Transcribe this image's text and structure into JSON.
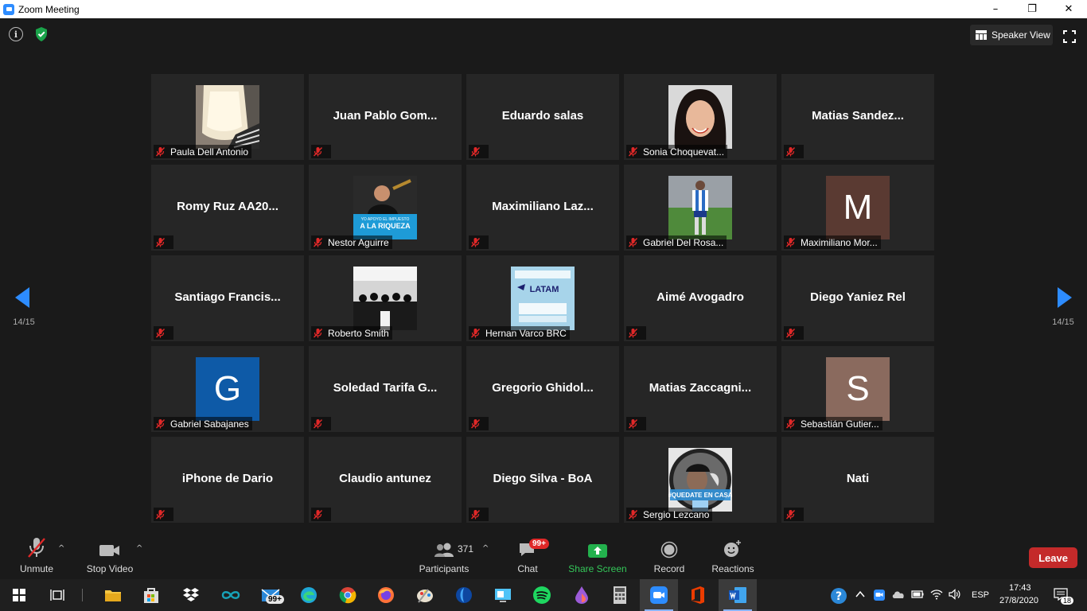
{
  "window": {
    "title": "Zoom Meeting",
    "controls": [
      "–",
      "❐",
      "✕"
    ]
  },
  "top": {
    "speaker_view_label": "Speaker View"
  },
  "pagination": {
    "left_label": "14/15",
    "right_label": "14/15"
  },
  "participants": [
    {
      "name": "Paula Dell Antonio",
      "kind": "photo",
      "photo": "blonde"
    },
    {
      "name": "Juan  Pablo Gom...",
      "kind": "name"
    },
    {
      "name": "Eduardo salas",
      "kind": "name"
    },
    {
      "name": "Sonia Choquevat...",
      "kind": "photo",
      "photo": "woman"
    },
    {
      "name": "Matias  Sandez...",
      "kind": "name"
    },
    {
      "name": "Romy Ruz AA20...",
      "kind": "name"
    },
    {
      "name": "Nestor Aguirre",
      "kind": "photo",
      "photo": "nestor",
      "photo_caption_1": "YO APOYO EL IMPUESTO",
      "photo_caption_2": "A LA RIQUEZA"
    },
    {
      "name": "Maximiliano  Laz...",
      "kind": "name"
    },
    {
      "name": "Gabriel Del Rosa...",
      "kind": "photo",
      "photo": "soccer"
    },
    {
      "name": "Maximiliano Mor...",
      "kind": "letter",
      "letter": "M",
      "color": "#5a3a32"
    },
    {
      "name": "Santiago  Francis...",
      "kind": "name"
    },
    {
      "name": "Roberto Smith",
      "kind": "photo",
      "photo": "room"
    },
    {
      "name": "Hernan Varco BRC",
      "kind": "photo",
      "photo": "latam",
      "photo_caption_1": "LATAM"
    },
    {
      "name": "Aimé Avogadro",
      "kind": "name"
    },
    {
      "name": "Diego Yaniez Rel",
      "kind": "name"
    },
    {
      "name": "Gabriel Sabajanes",
      "kind": "letter",
      "letter": "G",
      "color": "#0e5aa7"
    },
    {
      "name": "Soledad  Tarifa  G...",
      "kind": "name"
    },
    {
      "name": "Gregorio  Ghidol...",
      "kind": "name"
    },
    {
      "name": "Matias  Zaccagni...",
      "kind": "name"
    },
    {
      "name": "Sebastián Gutier...",
      "kind": "letter",
      "letter": "S",
      "color": "#8a6a5e"
    },
    {
      "name": "iPhone de Dario",
      "kind": "name"
    },
    {
      "name": "Claudio antunez",
      "kind": "name"
    },
    {
      "name": "Diego Silva - BoA",
      "kind": "name"
    },
    {
      "name": "Sergio Lezcano",
      "kind": "photo",
      "photo": "sergio",
      "photo_caption_1": "#QUEDATE EN CASA"
    },
    {
      "name": "Nati",
      "kind": "name"
    }
  ],
  "toolbar": {
    "unmute": "Unmute",
    "stop_video": "Stop Video",
    "participants": "Participants",
    "participants_count": "371",
    "chat": "Chat",
    "chat_badge": "99+",
    "share_screen": "Share Screen",
    "record": "Record",
    "reactions": "Reactions",
    "leave": "Leave"
  },
  "taskbar": {
    "mail_badge": "99+",
    "language": "ESP",
    "time": "17:43",
    "date": "27/8/2020",
    "notifications": "18"
  },
  "colors": {
    "accent_blue": "#2d8cff",
    "leave_red": "#c42a2a",
    "share_green": "#23b14d"
  }
}
